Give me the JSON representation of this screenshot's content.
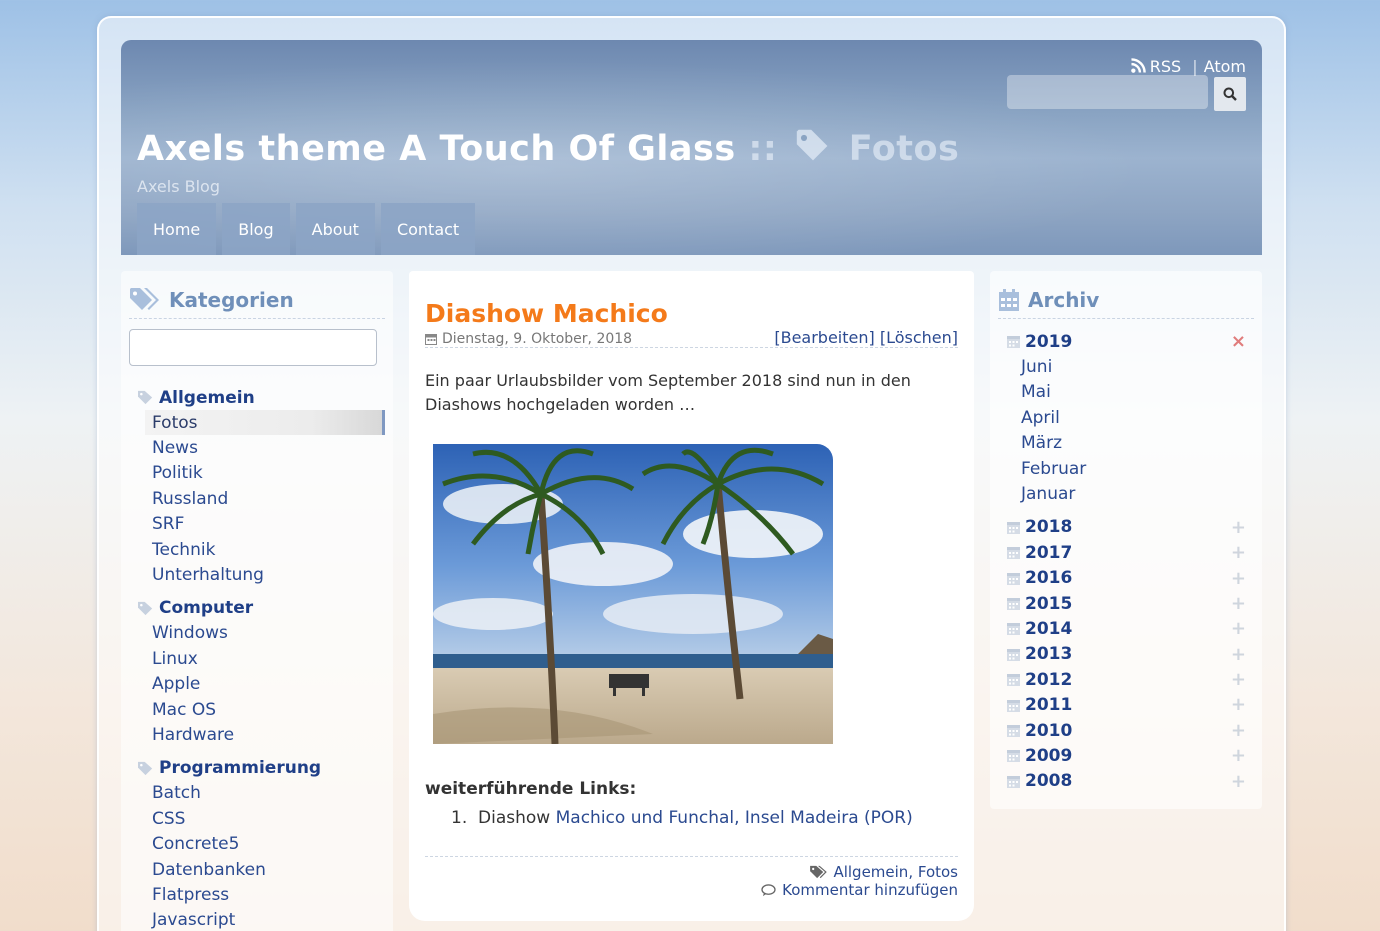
{
  "header": {
    "feeds": {
      "rss": "RSS",
      "separator": "|",
      "atom": "Atom"
    },
    "search": {
      "placeholder": ""
    },
    "title": "Axels theme A Touch Of Glass",
    "title_separator": "::",
    "current_category": "Fotos",
    "subtitle": "Axels Blog",
    "nav": [
      "Home",
      "Blog",
      "About",
      "Contact"
    ]
  },
  "sidebar_left": {
    "title": "Kategorien",
    "search": {
      "value": "",
      "placeholder": ""
    },
    "groups": [
      {
        "name": "Allgemein",
        "items": [
          "Fotos",
          "News",
          "Politik",
          "Russland",
          "SRF",
          "Technik",
          "Unterhaltung"
        ]
      },
      {
        "name": "Computer",
        "items": [
          "Windows",
          "Linux",
          "Apple",
          "Mac OS",
          "Hardware"
        ]
      },
      {
        "name": "Programmierung",
        "items": [
          "Batch",
          "CSS",
          "Concrete5",
          "Datenbanken",
          "Flatpress",
          "Javascript"
        ]
      }
    ],
    "active_item": "Fotos"
  },
  "post": {
    "title": "Diashow Machico",
    "date": "Dienstag, 9. Oktober, 2018",
    "edit_label": "[Bearbeiten]",
    "delete_label": "[Löschen]",
    "text": "Ein paar Urlaubsbilder vom September 2018 sind nun in den Diashows hochgeladen worden …",
    "links_title": "weiterführende Links:",
    "links": [
      {
        "number": "1.",
        "prefix": "Diashow",
        "link_text": "Machico und Funchal, Insel Madeira (POR)"
      }
    ],
    "tags_label": "Allgemein, Fotos",
    "comment_label": "Kommentar hinzufügen"
  },
  "sidebar_right": {
    "title": "Archiv",
    "expanded_year": "2019",
    "months": [
      "Juni",
      "Mai",
      "April",
      "März",
      "Februar",
      "Januar"
    ],
    "years": [
      "2018",
      "2017",
      "2016",
      "2015",
      "2014",
      "2013",
      "2012",
      "2011",
      "2010",
      "2009",
      "2008"
    ],
    "expand_symbol": "+",
    "collapse_symbol": "×"
  },
  "colors": {
    "link": "#2b4a90",
    "heading_accent": "#f47a1a",
    "widget_title": "#6f8fb9"
  }
}
